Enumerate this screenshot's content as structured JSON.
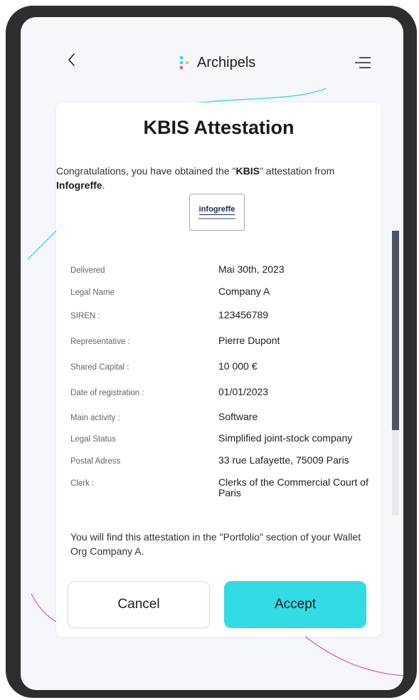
{
  "header": {
    "back_icon": "chevron-left-icon",
    "brand_name": "Archipels",
    "menu_icon": "menu-lines-icon"
  },
  "card": {
    "title": "KBIS Attestation",
    "intro_prefix": "Congratulations, you have obtained the \"",
    "intro_bold": "KBIS",
    "intro_middle": "\" attestation from ",
    "intro_issuer": "Infogreffe",
    "intro_suffix": ".",
    "logo_text": "infogreffe",
    "fields": [
      {
        "label": "Delivered",
        "value": "Mai 30th, 2023"
      },
      {
        "label": "Legal Name",
        "value": "Company A"
      },
      {
        "label": "SIREN :",
        "value": "123456789"
      },
      {
        "label": "Representative :",
        "value": "Pierre Dupont"
      },
      {
        "label": "Shared Capital :",
        "value": "10 000 €"
      },
      {
        "label": "Date of registration :",
        "value": "01/01/2023"
      },
      {
        "label": "Main activity :",
        "value": "Software"
      },
      {
        "label": "Legal Status",
        "value": "Simplified joint-stock company"
      },
      {
        "label": "Postal Adress",
        "value": "33 rue Lafayette, 75009 Paris"
      },
      {
        "label": "Clerk :",
        "value": "Clerks of the Commercial Court of Paris"
      }
    ],
    "footer_text": "You will find this attestation in the \"Portfolio\" section of your Wallet Org Company A.",
    "cancel_label": "Cancel",
    "accept_label": "Accept"
  },
  "colors": {
    "accent": "#33dbe5",
    "scroll_thumb": "#4e5362",
    "deco_cyan": "#2fd4dc",
    "deco_magenta": "#e04bd8"
  }
}
